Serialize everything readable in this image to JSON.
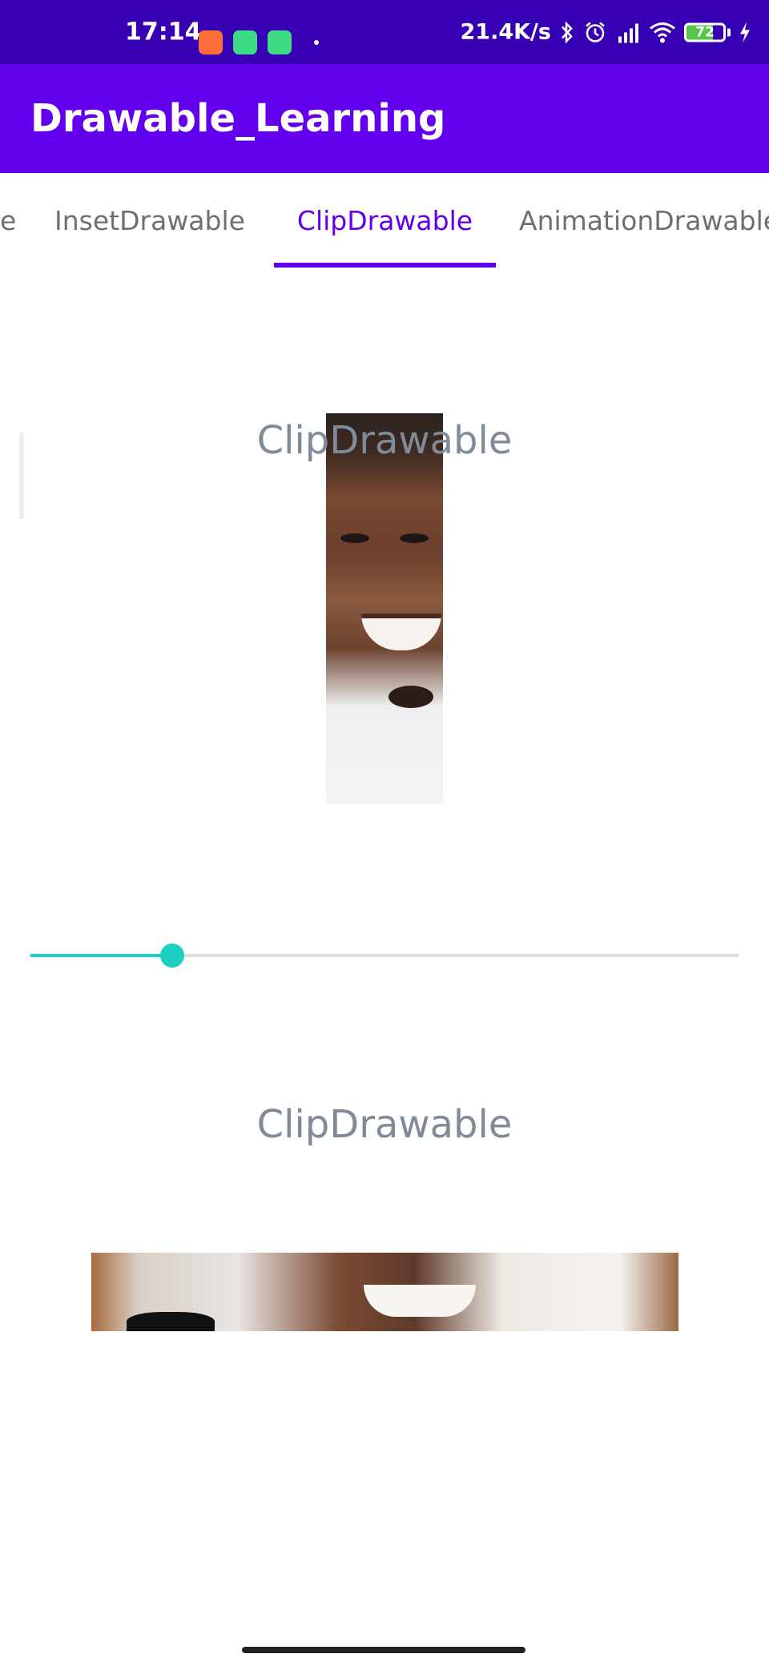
{
  "status_bar": {
    "time": "17:14",
    "network_speed": "21.4K/s",
    "battery_level": "72",
    "battery_fraction": 0.72,
    "notification_icons": [
      {
        "name": "video-recorder-icon",
        "color": "#ff6f3c"
      },
      {
        "name": "android-robot-icon",
        "color": "#3ddc84"
      },
      {
        "name": "android-robot-icon",
        "color": "#3ddc84"
      }
    ],
    "indicator_icons": [
      "bluetooth-icon",
      "alarm-icon",
      "hd-signal-icon",
      "wifi-icon",
      "battery-icon",
      "charging-icon"
    ]
  },
  "app_bar": {
    "title": "Drawable_Learning",
    "color": "#6200ee"
  },
  "tabs": {
    "items": [
      {
        "label": "e",
        "selected": false
      },
      {
        "label": "InsetDrawable",
        "selected": false
      },
      {
        "label": "ClipDrawable",
        "selected": true
      },
      {
        "label": "AnimationDrawable",
        "selected": false
      }
    ],
    "selected_color": "#6200ee"
  },
  "content": {
    "clip_label": "ClipDrawable",
    "second_label": "ClipDrawable",
    "seekbar": {
      "progress_fraction": 0.2,
      "color": "#1ccfc2"
    }
  }
}
